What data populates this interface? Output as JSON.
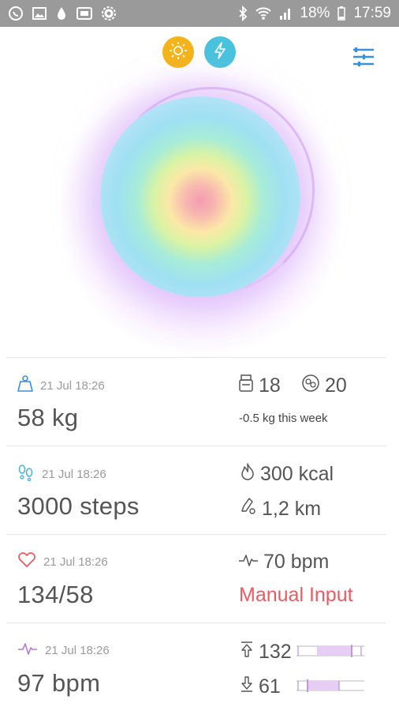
{
  "status_bar": {
    "battery": "18%",
    "time": "17:59"
  },
  "header": {
    "sun_icon": "sun-icon",
    "bolt_icon": "lightning-icon",
    "menu_icon": "sliders-icon"
  },
  "weight": {
    "timestamp": "21 Jul 18:26",
    "value": "58 kg",
    "stat1": "18",
    "stat2": "20",
    "note": "-0.5 kg this week"
  },
  "steps": {
    "timestamp": "21 Jul 18:26",
    "value": "3000 steps",
    "kcal": "300 kcal",
    "distance": "1,2 km"
  },
  "blood_pressure": {
    "timestamp": "21 Jul 18:26",
    "value": "134/58",
    "pulse": "70 bpm",
    "source": "Manual Input"
  },
  "heart_rate": {
    "timestamp": "21 Jul 18:26",
    "value": "97 bpm",
    "max": "132",
    "min": "61"
  },
  "colors": {
    "accent_orange": "#f4b419",
    "accent_cyan": "#49c3dd",
    "alert_red": "#ee5a62",
    "heart_purple": "#b57bd6"
  }
}
